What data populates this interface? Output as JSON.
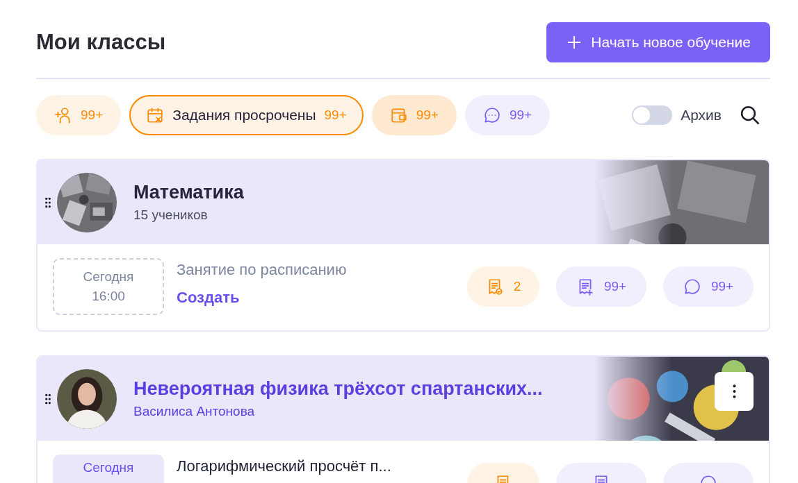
{
  "page": {
    "title": "Мои классы",
    "new_button": "Начать новое обучение"
  },
  "filters": [
    {
      "kind": "students",
      "count": "99+",
      "color": "#ff8a00",
      "selected": false
    },
    {
      "kind": "overdue",
      "label": "Задания просрочены",
      "count": "99+",
      "color": "#ff8a00",
      "selected": true
    },
    {
      "kind": "payments",
      "count": "99+",
      "color": "#ff8a00",
      "selected": false
    },
    {
      "kind": "messages",
      "count": "99+",
      "color": "#7a5af8",
      "selected": false
    }
  ],
  "archive": {
    "label": "Архив",
    "on": false
  },
  "classes": [
    {
      "title": "Математика",
      "subtitle": "15 учеников",
      "highlighted": false,
      "menu_shown": false,
      "lesson": {
        "scheduled": false,
        "day": "Сегодня",
        "time": "16:00",
        "title": "Занятие по расписанию",
        "action": "Создать"
      },
      "chips": [
        {
          "kind": "checked",
          "count": "2",
          "color": "#ff8a00"
        },
        {
          "kind": "homework",
          "count": "99+",
          "color": "#7a5af8"
        },
        {
          "kind": "chat",
          "count": "99+",
          "color": "#7a5af8"
        }
      ]
    },
    {
      "title": "Невероятная физика трёхсот спартанских...",
      "subtitle": "Василиса Антонова",
      "highlighted": true,
      "menu_shown": true,
      "lesson": {
        "scheduled": true,
        "day": "Сегодня",
        "title": "Логарифмический просчёт п..."
      },
      "chips": [
        {
          "kind": "checked",
          "color": "#ff8a00"
        },
        {
          "kind": "homework",
          "color": "#7a5af8"
        },
        {
          "kind": "chat",
          "color": "#7a5af8"
        }
      ]
    }
  ]
}
